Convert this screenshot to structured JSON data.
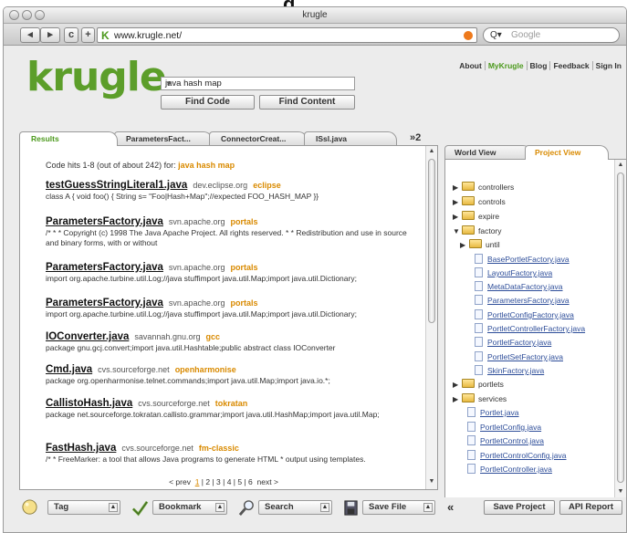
{
  "top_label": "g",
  "window": {
    "title": "krugle"
  },
  "toolbar": {
    "back": "◂",
    "forward": "▸",
    "reload": "c",
    "add": "+",
    "url": "www.krugle.net/",
    "url_icon": "K",
    "search_placeholder": "Google",
    "search_prefix": "Q▾"
  },
  "header": {
    "logo": "krugle",
    "query": "java hash map",
    "find_code": "Find Code",
    "find_content": "Find Content",
    "links": [
      "About",
      "MyKrugle",
      "Blog",
      "Feedback",
      "Sign In"
    ]
  },
  "left_tabs": {
    "tabs": [
      "Results",
      "ParametersFact...",
      "ConnectorCreat...",
      "ISsl.java"
    ],
    "more": "»2"
  },
  "results": {
    "summary_prefix": "Code hits 1-8 (out of about 242) for:",
    "summary_query": "java hash map",
    "items": [
      {
        "title": "testGuessStringLiteral1.java",
        "source": "dev.eclipse.org",
        "project": "eclipse",
        "snippet": "class A { void foo() { String s= \"Foo|Hash+Map\";//expected FOO_HASH_MAP }}"
      },
      {
        "title": "ParametersFactory.java",
        "source": "svn.apache.org",
        "project": "portals",
        "snippet": "/* * * Copyright (c) 1998 The Java Apache Project. All rights reserved. * * Redistribution and use in source and binary forms, with or without"
      },
      {
        "title": "ParametersFactory.java",
        "source": "svn.apache.org",
        "project": "portals",
        "snippet": "import org.apache.turbine.util.Log;//java stuffimport java.util.Map;import java.util.Dictionary;"
      },
      {
        "title": "ParametersFactory.java",
        "source": "svn.apache.org",
        "project": "portals",
        "snippet": "import org.apache.turbine.util.Log;//java stuffimport java.util.Map;import java.util.Dictionary;"
      },
      {
        "title": "IOConverter.java",
        "source": "savannah.gnu.org",
        "project": "gcc",
        "snippet": "package gnu.gcj.convert;import java.util.Hashtable;public abstract class IOConverter"
      },
      {
        "title": "Cmd.java",
        "source": "cvs.sourceforge.net",
        "project": "openharmonise",
        "snippet": "package org.openharmonise.telnet.commands;import java.util.Map;import java.io.*;"
      },
      {
        "title": "CallistoHash.java",
        "source": "cvs.sourceforge.net",
        "project": "tokratan",
        "snippet": "package net.sourceforge.tokratan.callisto.grammar;import java.util.HashMap;import java.util.Map;"
      },
      {
        "title": "FastHash.java",
        "source": "cvs.sourceforge.net",
        "project": "fm-classic",
        "snippet": "/* * FreeMarker: a tool that allows Java programs to generate HTML * output using templates."
      }
    ],
    "pager": {
      "prev": "< prev",
      "pages": [
        "1",
        "2",
        "3",
        "4",
        "5",
        "6"
      ],
      "next": "next >"
    }
  },
  "right_tabs": {
    "tabs": [
      "World View",
      "Project View"
    ]
  },
  "tree": {
    "items": [
      {
        "label": "controllers",
        "kind": "folder",
        "tri": "▶"
      },
      {
        "label": "controls",
        "kind": "folder",
        "tri": "▶"
      },
      {
        "label": "expire",
        "kind": "folder",
        "tri": "▶"
      },
      {
        "label": "factory",
        "kind": "folder",
        "tri": "▼"
      },
      {
        "label": "until",
        "kind": "folder",
        "tri": "▶"
      },
      {
        "label": "BasePortletFactory.java",
        "kind": "file"
      },
      {
        "label": "LayoutFactory.java",
        "kind": "file"
      },
      {
        "label": "MetaDataFactory.java",
        "kind": "file"
      },
      {
        "label": "ParametersFactory.java",
        "kind": "file"
      },
      {
        "label": "PortletConfigFactory.java",
        "kind": "file"
      },
      {
        "label": "PortletControllerFactory.java",
        "kind": "file"
      },
      {
        "label": "PortletFactory.java",
        "kind": "file"
      },
      {
        "label": "PortletSetFactory.java",
        "kind": "file"
      },
      {
        "label": "SkinFactory.java",
        "kind": "file"
      },
      {
        "label": "portlets",
        "kind": "folder",
        "tri": "▶"
      },
      {
        "label": "services",
        "kind": "folder",
        "tri": "▶"
      },
      {
        "label": "Portlet.java",
        "kind": "file"
      },
      {
        "label": "PortletConfig.java",
        "kind": "file"
      },
      {
        "label": "PortletControl.java",
        "kind": "file"
      },
      {
        "label": "PortletControlConfig.java",
        "kind": "file"
      },
      {
        "label": "PortletController.java",
        "kind": "file"
      }
    ]
  },
  "bottombar": {
    "tag": "Tag",
    "bookmark": "Bookmark",
    "search": "Search",
    "save_file": "Save File",
    "collapse": "«",
    "save_project": "Save Project",
    "api_report": "API Report"
  }
}
